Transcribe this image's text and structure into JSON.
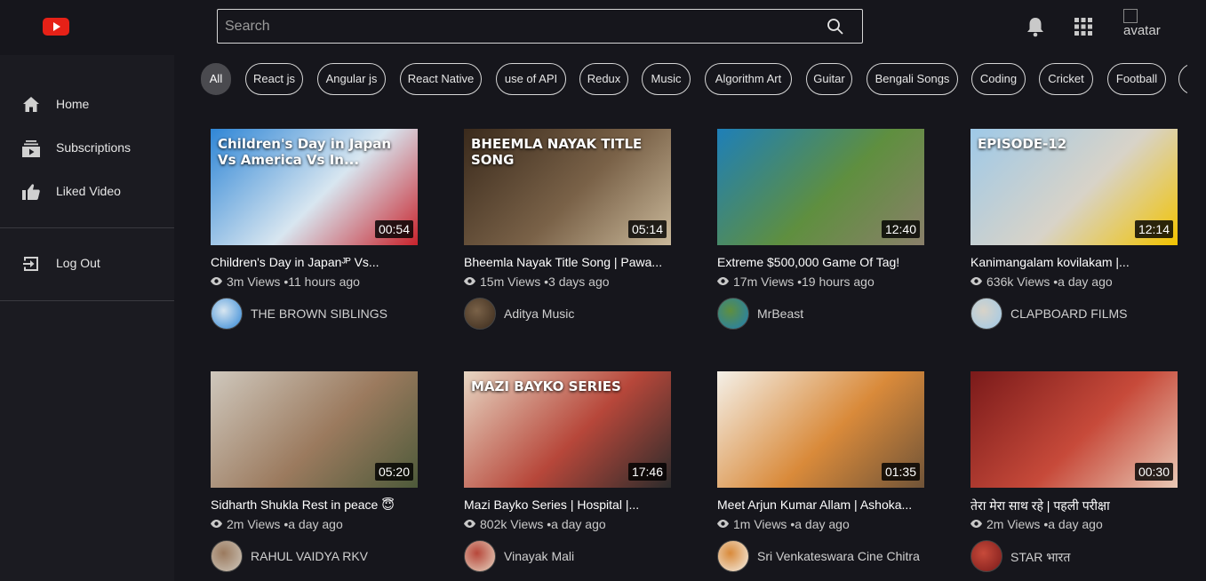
{
  "header": {
    "search_placeholder": "Search",
    "avatar_alt": "avatar"
  },
  "sidebar": {
    "items": [
      {
        "label": "Home",
        "icon": "home-icon"
      },
      {
        "label": "Subscriptions",
        "icon": "subscriptions-icon"
      },
      {
        "label": "Liked Video",
        "icon": "thumbs-up-icon"
      },
      {
        "label": "Log Out",
        "icon": "logout-icon"
      }
    ]
  },
  "chips": [
    {
      "label": "All",
      "active": true
    },
    {
      "label": "React js"
    },
    {
      "label": "Angular js"
    },
    {
      "label": "React Native"
    },
    {
      "label": "use of API"
    },
    {
      "label": "Redux"
    },
    {
      "label": "Music"
    },
    {
      "label": "Algorithm Art"
    },
    {
      "label": "Guitar"
    },
    {
      "label": "Bengali Songs"
    },
    {
      "label": "Coding"
    },
    {
      "label": "Cricket"
    },
    {
      "label": "Football"
    }
  ],
  "videos": [
    {
      "title": "Children's Day in Japanᴶᴾ Vs...",
      "views": "3m Views",
      "age": "11 hours ago",
      "duration": "00:54",
      "channel": "THE BROWN SIBLINGS",
      "thumb_overlay": "Children's Day in Japan Vs America Vs In...",
      "colors": [
        "#2f86d6",
        "#d8e6f0",
        "#c8232c"
      ]
    },
    {
      "title": "Bheemla Nayak Title Song | Pawa...",
      "views": "15m Views",
      "age": "3 days ago",
      "duration": "05:14",
      "channel": "Aditya Music",
      "thumb_overlay": "BHEEMLA NAYAK TITLE SONG",
      "colors": [
        "#3a2a1c",
        "#7a6248",
        "#c9b89a"
      ]
    },
    {
      "title": "Extreme $500,000 Game Of Tag!",
      "views": "17m Views",
      "age": "19 hours ago",
      "duration": "12:40",
      "channel": "MrBeast",
      "thumb_overlay": "",
      "colors": [
        "#1e7fb8",
        "#5f8f3f",
        "#8a7f6a"
      ]
    },
    {
      "title": "Kanimangalam kovilakam |...",
      "views": "636k Views",
      "age": "a day ago",
      "duration": "12:14",
      "channel": "CLAPBOARD FILMS",
      "thumb_overlay": "EPISODE-12",
      "colors": [
        "#9ec9e8",
        "#d8d3c8",
        "#f2c300"
      ]
    },
    {
      "title": "Sidharth Shukla Rest in peace 😇",
      "views": "2m Views",
      "age": "a day ago",
      "duration": "05:20",
      "channel": "RAHUL VAIDYA RKV",
      "thumb_overlay": "",
      "colors": [
        "#cfc8bd",
        "#9b7a5e",
        "#4d5a3a"
      ]
    },
    {
      "title": "Mazi Bayko Series | Hospital |...",
      "views": "802k Views",
      "age": "a day ago",
      "duration": "17:46",
      "channel": "Vinayak Mali",
      "thumb_overlay": "MAZI BAYKO SERIES",
      "colors": [
        "#e7d6c3",
        "#b7473a",
        "#2b2b2b"
      ]
    },
    {
      "title": "Meet Arjun Kumar Allam | Ashoka...",
      "views": "1m Views",
      "age": "a day ago",
      "duration": "01:35",
      "channel": "Sri Venkateswara Cine Chitra",
      "thumb_overlay": "",
      "colors": [
        "#f4f0e8",
        "#d98a3a",
        "#6f5338"
      ]
    },
    {
      "title": "तेरा मेरा साथ रहे | पहली परीक्षा",
      "views": "2m Views",
      "age": "a day ago",
      "duration": "00:30",
      "channel": "STAR भारत",
      "thumb_overlay": "",
      "colors": [
        "#7a1a1a",
        "#c74a3a",
        "#e9c9b6"
      ]
    }
  ],
  "accent_color": "#e62117"
}
